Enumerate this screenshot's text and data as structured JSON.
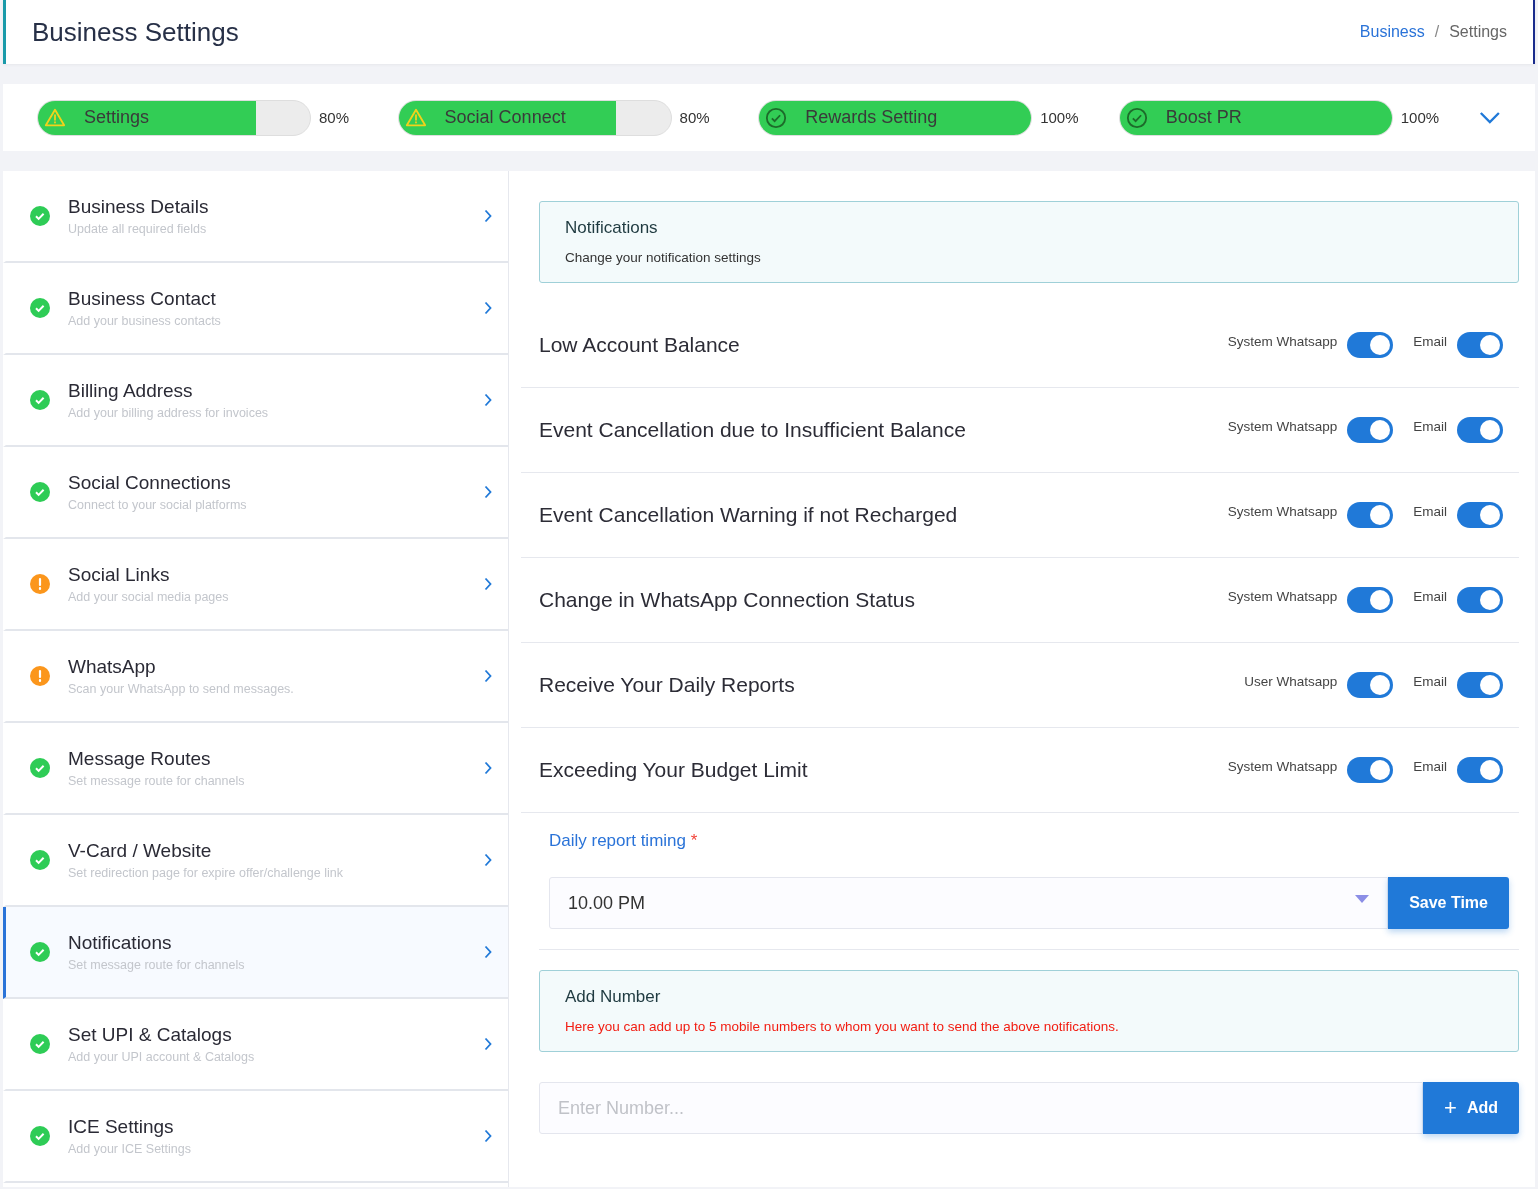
{
  "header": {
    "title": "Business Settings",
    "breadcrumb": [
      {
        "label": "Business",
        "kind": "link"
      },
      {
        "label": "Settings",
        "kind": "current"
      }
    ],
    "separator": "/"
  },
  "progress": [
    {
      "label": "Settings",
      "level": 0.8,
      "reading": "80%",
      "kind": "warning"
    },
    {
      "label": "Social Connect",
      "level": 0.8,
      "reading": "80%",
      "kind": "warning"
    },
    {
      "label": "Rewards Setting",
      "level": 1,
      "reading": "100%",
      "kind": "done"
    },
    {
      "label": "Boost PR",
      "level": 1,
      "reading": "100%",
      "kind": "done"
    }
  ],
  "sidebar": {
    "items": [
      {
        "title": "Business Details",
        "subtitle": "Update all required fields",
        "kind": "done",
        "selected": false
      },
      {
        "title": "Business Contact",
        "subtitle": "Add your business contacts",
        "kind": "done",
        "selected": false
      },
      {
        "title": "Billing Address",
        "subtitle": "Add your billing address for invoices",
        "kind": "done",
        "selected": false
      },
      {
        "title": "Social Connections",
        "subtitle": "Connect to your social platforms",
        "kind": "done",
        "selected": false
      },
      {
        "title": "Social Links",
        "subtitle": "Add your social media pages",
        "kind": "warning",
        "selected": false
      },
      {
        "title": "WhatsApp",
        "subtitle": "Scan your WhatsApp to send messages.",
        "kind": "warning",
        "selected": false
      },
      {
        "title": "Message Routes",
        "subtitle": "Set message route for channels",
        "kind": "done",
        "selected": false
      },
      {
        "title": "V-Card / Website",
        "subtitle": "Set redirection page for expire offer/challenge link",
        "kind": "done",
        "selected": false
      },
      {
        "title": "Notifications",
        "subtitle": "Set message route for channels",
        "kind": "done",
        "selected": true
      },
      {
        "title": "Set UPI & Catalogs",
        "subtitle": "Add your UPI account & Catalogs",
        "kind": "done",
        "selected": false
      },
      {
        "title": "ICE Settings",
        "subtitle": "Add your ICE Settings",
        "kind": "done",
        "selected": false
      }
    ]
  },
  "notifications_info": {
    "title": "Notifications",
    "text": "Change your notification settings"
  },
  "notifications": [
    {
      "title": "Low Account Balance",
      "channels": [
        {
          "label": "System Whatsapp",
          "on": true
        },
        {
          "label": "Email",
          "on": true
        }
      ]
    },
    {
      "title": "Event Cancellation due to Insufficient Balance",
      "channels": [
        {
          "label": "System Whatsapp",
          "on": true
        },
        {
          "label": "Email",
          "on": true
        }
      ]
    },
    {
      "title": "Event Cancellation Warning if not Recharged",
      "channels": [
        {
          "label": "System Whatsapp",
          "on": true
        },
        {
          "label": "Email",
          "on": true
        }
      ]
    },
    {
      "title": "Change in WhatsApp Connection Status",
      "channels": [
        {
          "label": "System Whatsapp",
          "on": true
        },
        {
          "label": "Email",
          "on": true
        }
      ]
    },
    {
      "title": "Receive Your Daily Reports",
      "channels": [
        {
          "label": "User Whatsapp",
          "on": true
        },
        {
          "label": "Email",
          "on": true
        }
      ]
    },
    {
      "title": "Exceeding Your Budget Limit",
      "channels": [
        {
          "label": "System Whatsapp",
          "on": true
        },
        {
          "label": "Email",
          "on": true
        }
      ]
    }
  ],
  "daily_report": {
    "label": "Daily report timing",
    "required_mark": "*",
    "value": "10.00 PM",
    "button": "Save Time"
  },
  "add_number_info": {
    "title": "Add Number",
    "text": "Here you can add up to 5 mobile numbers to whom you want to send the above notifications."
  },
  "add_number": {
    "placeholder": "Enter Number...",
    "button": "Add",
    "button_icon": "+"
  }
}
